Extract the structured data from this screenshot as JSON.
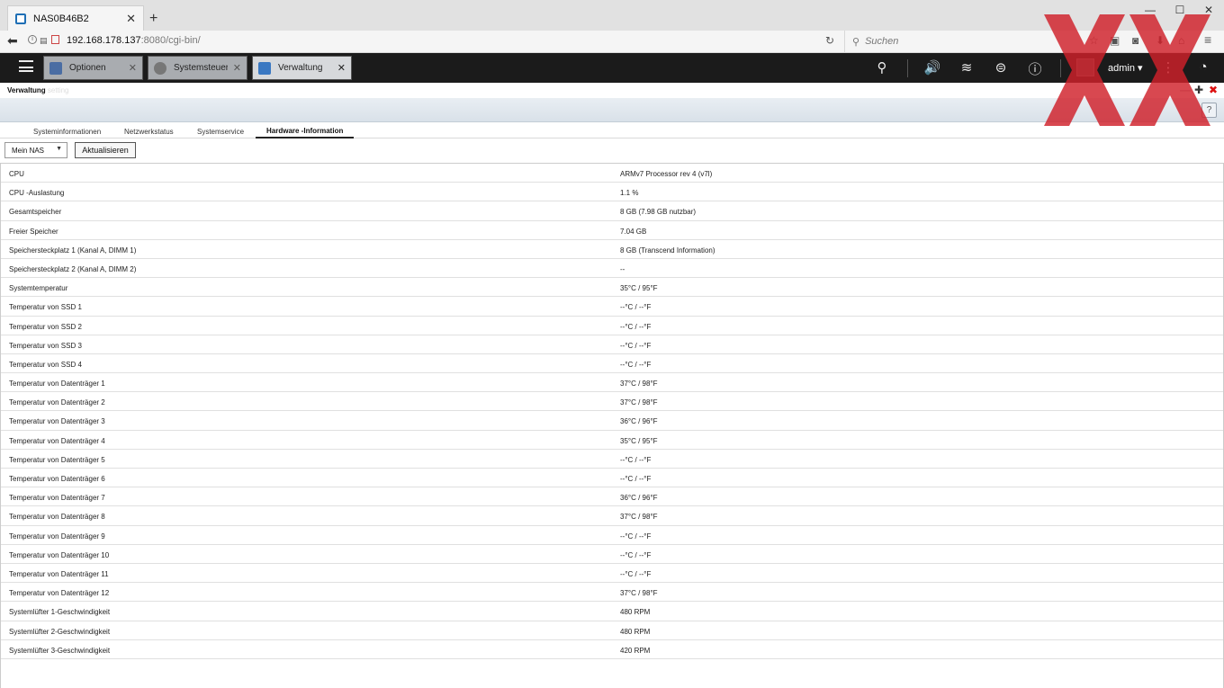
{
  "browser": {
    "tab_title": "NAS0B46B2",
    "url_host": "192.168.178.137",
    "url_rest": ":8080/cgi-bin/",
    "search_placeholder": "Suchen"
  },
  "qts": {
    "tabs": [
      {
        "label": "Optionen"
      },
      {
        "label": "Systemsteueru..."
      },
      {
        "label": "Verwaltung"
      }
    ],
    "user": "admin"
  },
  "window": {
    "title": "Verwaltung",
    "ghost_title": "setting",
    "help": "?"
  },
  "subtabs": [
    "Systeminformationen",
    "Netzwerkstatus",
    "Systemservice",
    "Hardware -Information"
  ],
  "controls": {
    "selector": "Mein NAS",
    "refresh": "Aktualisieren"
  },
  "hardware_info": [
    {
      "key": "CPU",
      "value": "ARMv7 Processor rev 4 (v7l)"
    },
    {
      "key": "CPU -Auslastung",
      "value": "1.1 %"
    },
    {
      "key": "Gesamtspeicher",
      "value": "8 GB (7.98 GB nutzbar)"
    },
    {
      "key": "Freier Speicher",
      "value": "7.04 GB"
    },
    {
      "key": "Speichersteckplatz 1 (Kanal A, DIMM 1)",
      "value": "8 GB (Transcend Information)"
    },
    {
      "key": "Speichersteckplatz 2 (Kanal A, DIMM 2)",
      "value": "--"
    },
    {
      "key": "Systemtemperatur",
      "value": "35°C / 95°F"
    },
    {
      "key": "Temperatur von SSD 1",
      "value": "--°C / --°F"
    },
    {
      "key": "Temperatur von SSD 2",
      "value": "--°C / --°F"
    },
    {
      "key": "Temperatur von SSD 3",
      "value": "--°C / --°F"
    },
    {
      "key": "Temperatur von SSD 4",
      "value": "--°C / --°F"
    },
    {
      "key": "Temperatur von Datenträger 1",
      "value": "37°C / 98°F"
    },
    {
      "key": "Temperatur von Datenträger 2",
      "value": "37°C / 98°F"
    },
    {
      "key": "Temperatur von Datenträger 3",
      "value": "36°C / 96°F"
    },
    {
      "key": "Temperatur von Datenträger 4",
      "value": "35°C / 95°F"
    },
    {
      "key": "Temperatur von Datenträger 5",
      "value": "--°C / --°F"
    },
    {
      "key": "Temperatur von Datenträger 6",
      "value": "--°C / --°F"
    },
    {
      "key": "Temperatur von Datenträger 7",
      "value": "36°C / 96°F"
    },
    {
      "key": "Temperatur von Datenträger 8",
      "value": "37°C / 98°F"
    },
    {
      "key": "Temperatur von Datenträger 9",
      "value": "--°C / --°F"
    },
    {
      "key": "Temperatur von Datenträger 10",
      "value": "--°C / --°F"
    },
    {
      "key": "Temperatur von Datenträger 11",
      "value": "--°C / --°F"
    },
    {
      "key": "Temperatur von Datenträger 12",
      "value": "37°C / 98°F"
    },
    {
      "key": "Systemlüfter 1-Geschwindigkeit",
      "value": "480 RPM"
    },
    {
      "key": "Systemlüfter 2-Geschwindigkeit",
      "value": "480 RPM"
    },
    {
      "key": "Systemlüfter 3-Geschwindigkeit",
      "value": "420 RPM"
    }
  ],
  "colors": {
    "qts_bar": "#1b1b1b",
    "watermark": "#d0202a"
  }
}
